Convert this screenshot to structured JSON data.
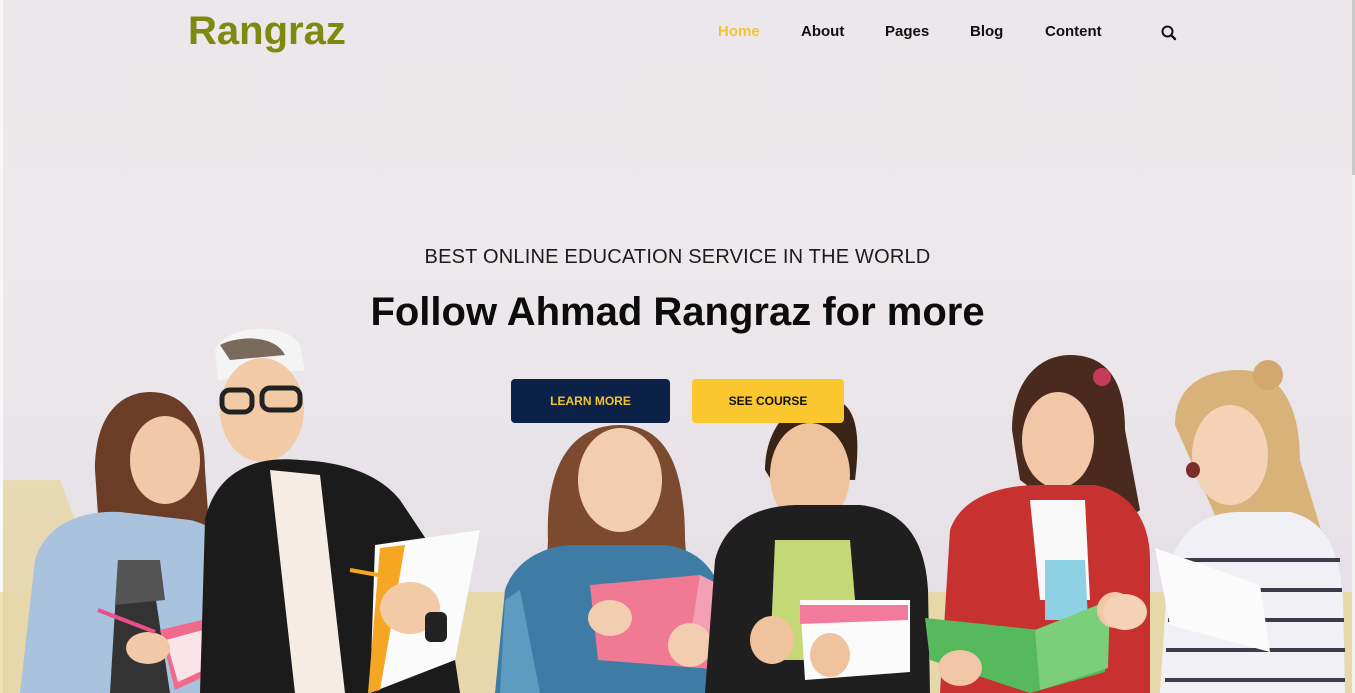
{
  "brand": {
    "name": "Rangraz"
  },
  "nav": {
    "items": [
      {
        "label": "Home",
        "active": true
      },
      {
        "label": "About",
        "active": false
      },
      {
        "label": "Pages",
        "active": false
      },
      {
        "label": "Blog",
        "active": false
      },
      {
        "label": "Content",
        "active": false
      }
    ],
    "search_icon": "search-icon"
  },
  "hero": {
    "tagline": "BEST ONLINE EDUCATION SERVICE IN THE WORLD",
    "headline": "Follow Ahmad Rangraz for more",
    "buttons": {
      "learn_more": "LEARN MORE",
      "see_course": "SEE COURSE"
    },
    "image": "students-reading-notebooks-photo"
  },
  "colors": {
    "brand": "#7d8a10",
    "nav_active": "#f4c430",
    "primary_button": "#0c2147",
    "accent_button": "#fbc72e",
    "background": "#ebe7ea"
  }
}
